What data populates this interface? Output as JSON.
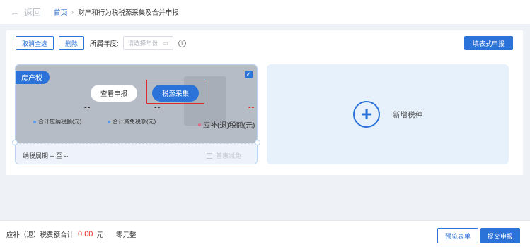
{
  "header": {
    "back_label": "返回",
    "breadcrumb_home": "首页",
    "breadcrumb_sep": "›",
    "breadcrumb_current": "财产和行为税税源采集及合并申报"
  },
  "toolbar": {
    "deselect_all": "取消全选",
    "delete": "删除",
    "year_label": "所属年度:",
    "year_placeholder": "请选择年份",
    "fill_form": "填表式申报"
  },
  "tax_card": {
    "tag": "房产税",
    "view_report": "查看申报",
    "collect": "税源采集",
    "values": [
      "--",
      "--",
      "--"
    ],
    "metrics": [
      "合计应纳税额(元)",
      "合计减免税额(元)",
      "应补(退)税额(元)"
    ],
    "period": "纳税属期 -- 至 --",
    "reduction": "普惠减免",
    "colors": {
      "metric1_dot": "#5b9be8",
      "metric2_dot": "#5b9be8",
      "metric3_dot": "#e06b8b",
      "alert": "#e02a2a"
    }
  },
  "add_card": {
    "label": "新增税种"
  },
  "footer": {
    "sum_label": "应补（退）税费额合计",
    "sum_value": "0.00",
    "sum_unit": "元",
    "sum_words": "零元整",
    "preview": "预览表单",
    "submit": "提交申报"
  }
}
